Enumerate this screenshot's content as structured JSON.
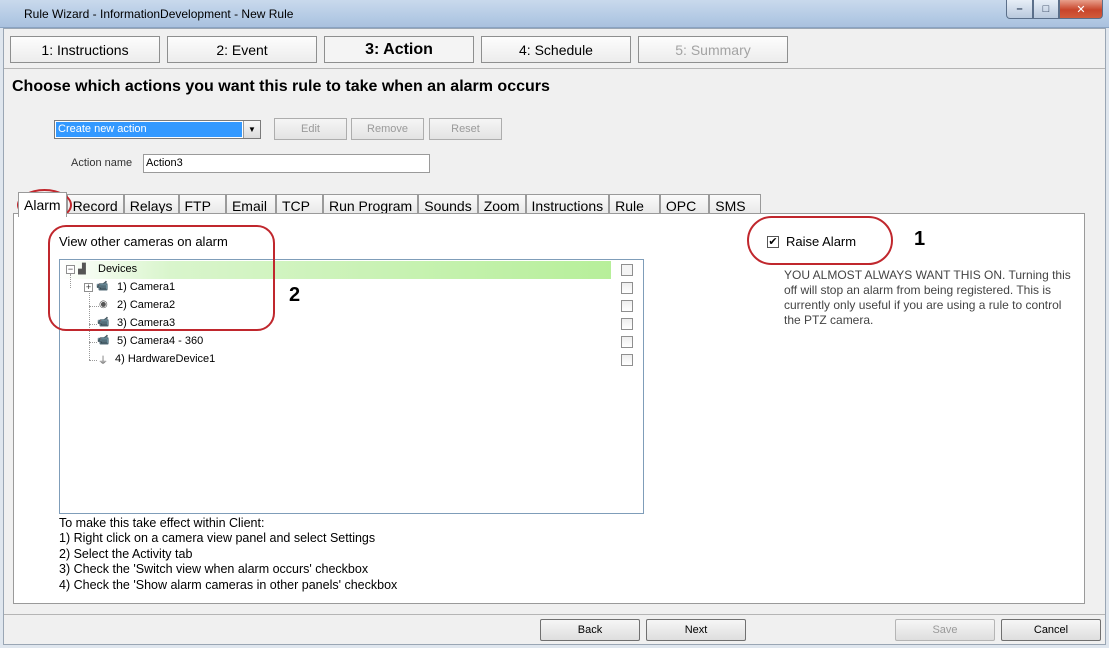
{
  "window": {
    "title": "Rule Wizard - InformationDevelopment - New Rule",
    "controls": {
      "minimize": "–",
      "maximize": "□",
      "close": "✕"
    }
  },
  "steps": [
    {
      "label": "1: Instructions",
      "state": "normal"
    },
    {
      "label": "2: Event",
      "state": "normal"
    },
    {
      "label": "3: Action",
      "state": "active"
    },
    {
      "label": "4: Schedule",
      "state": "normal"
    },
    {
      "label": "5: Summary",
      "state": "disabled"
    }
  ],
  "heading": "Choose which actions you want this rule to take when an alarm occurs",
  "action": {
    "selected": "Create new action",
    "edit_label": "Edit",
    "remove_label": "Remove",
    "reset_label": "Reset",
    "name_label": "Action name",
    "name_value": "Action3"
  },
  "tabs": [
    "Alarm",
    "Record",
    "Relays",
    "FTP",
    "Email",
    "TCP",
    "Run Program",
    "Sounds",
    "Zoom",
    "Instructions",
    "Rule",
    "OPC",
    "SMS"
  ],
  "alarm": {
    "view_label": "View other cameras on alarm",
    "tree": [
      {
        "label": "Devices"
      },
      {
        "label": "1) Camera1"
      },
      {
        "label": "2) Camera2"
      },
      {
        "label": "3) Camera3"
      },
      {
        "label": "5) Camera4 - 360"
      },
      {
        "label": "4) HardwareDevice1"
      }
    ],
    "instructions": [
      "To make this take effect within  Client:",
      "1) Right click on a camera view panel and select Settings",
      "2) Select the Activity tab",
      "3) Check the 'Switch view when alarm occurs' checkbox",
      "4) Check the 'Show alarm cameras in other panels' checkbox"
    ],
    "raise_label": "Raise Alarm",
    "raise_checked": true,
    "raise_mark": "✔",
    "raise_note": "YOU ALMOST ALWAYS WANT THIS ON. Turning this off will stop an alarm from being registered.  This is currently only useful if you are using a rule to control the PTZ camera.",
    "markers": [
      "1",
      "2"
    ]
  },
  "buttons": {
    "back": "Back",
    "next": "Next",
    "save": "Save",
    "cancel": "Cancel"
  },
  "colors": {
    "annotation": "#c0272d",
    "selection": "#3399ff"
  }
}
